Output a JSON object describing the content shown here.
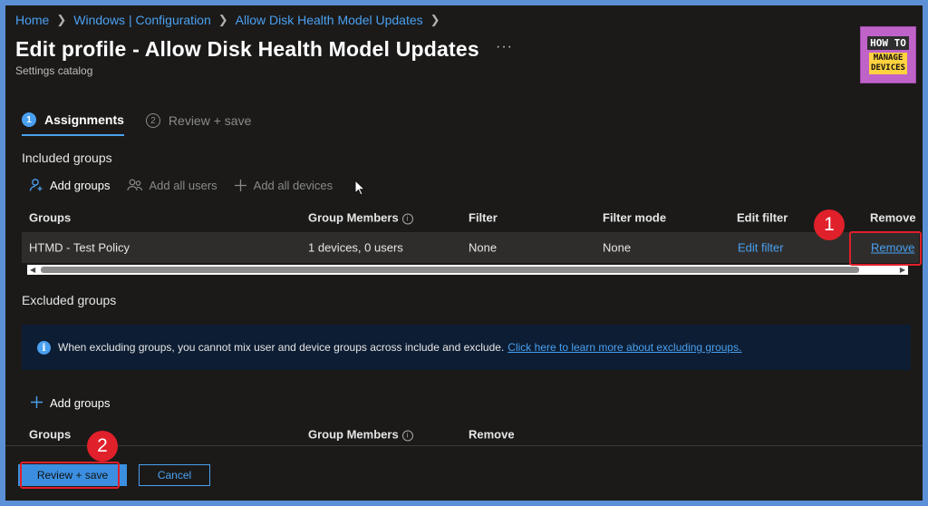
{
  "breadcrumb": [
    "Home",
    "Windows | Configuration",
    "Allow Disk Health Model Updates"
  ],
  "page": {
    "title": "Edit profile - Allow Disk Health Model Updates",
    "subtitle": "Settings catalog",
    "more_label": "···"
  },
  "logo": {
    "line1": "HOW TO",
    "line2a": "MANAGE",
    "line2b": "DEVICES"
  },
  "steps": [
    {
      "num": "1",
      "label": "Assignments",
      "state": "active"
    },
    {
      "num": "2",
      "label": "Review + save",
      "state": "inactive"
    }
  ],
  "included": {
    "title": "Included groups",
    "commands": [
      {
        "icon": "add-user-icon",
        "label": "Add groups",
        "enabled": true
      },
      {
        "icon": "people-icon",
        "label": "Add all users",
        "enabled": false
      },
      {
        "icon": "plus-icon",
        "label": "Add all devices",
        "enabled": false
      }
    ],
    "columns": [
      "Groups",
      "Group Members",
      "Filter",
      "Filter mode",
      "Edit filter",
      "Remove"
    ],
    "rows": [
      {
        "group": "HTMD - Test Policy",
        "members": "1 devices, 0 users",
        "filter": "None",
        "filter_mode": "None",
        "edit_filter": "Edit filter",
        "remove": "Remove"
      }
    ]
  },
  "excluded": {
    "title": "Excluded groups",
    "info_message": "When excluding groups, you cannot mix user and device groups across include and exclude.",
    "info_link": "Click here to learn more about excluding groups.",
    "add_label": "Add groups",
    "columns": [
      "Groups",
      "Group Members",
      "Remove"
    ]
  },
  "footer": {
    "primary": "Review + save",
    "secondary": "Cancel"
  },
  "annotations": [
    "1",
    "2"
  ],
  "colors": {
    "accent": "#4aa0f0",
    "background": "#1b1a19",
    "annotation": "#e0202a",
    "info_bg": "#0d1d33"
  }
}
